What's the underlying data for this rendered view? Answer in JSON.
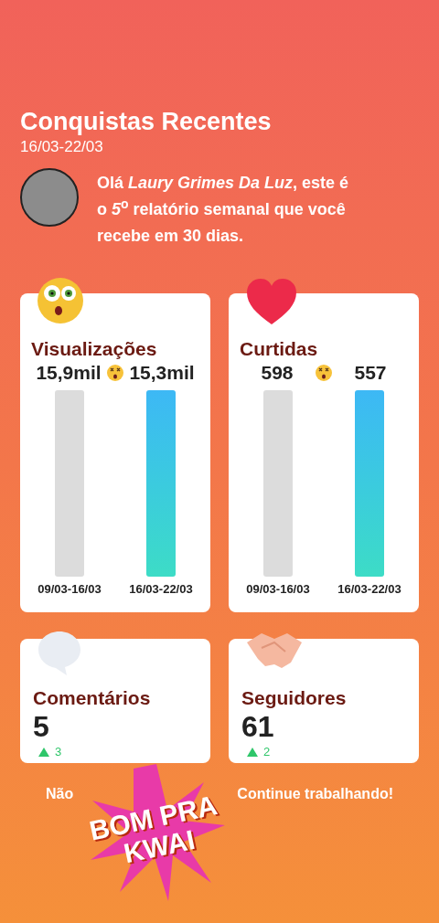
{
  "header": {
    "title": "Conquistas Recentes",
    "date_range": "16/03-22/03"
  },
  "greeting": "Olá *Laury Grimes Da Luz*, este é o *5*$^{o}$ relatório semanal que você recebe em 30 dias.",
  "chart_cards": [
    {
      "kind": "eyes",
      "title": "Visualizações",
      "previous": {
        "value": "15,9mil",
        "period": "09/03-16/03"
      },
      "current": {
        "value": "15,3mil",
        "period": "16/03-22/03"
      }
    },
    {
      "kind": "heart",
      "title": "Curtidas",
      "previous": {
        "value": "598",
        "period": "09/03-16/03"
      },
      "current": {
        "value": "557",
        "period": "16/03-22/03"
      }
    }
  ],
  "stat_cards": [
    {
      "kind": "speech",
      "title": "Comentários",
      "value": "5",
      "change": "3"
    },
    {
      "kind": "handshake",
      "title": "Seguidores",
      "value": "61",
      "change": "2"
    }
  ],
  "footer": [
    "Não",
    "Continue trabalhando!"
  ],
  "sticker": [
    "BOM PRA",
    "KWAI"
  ]
}
